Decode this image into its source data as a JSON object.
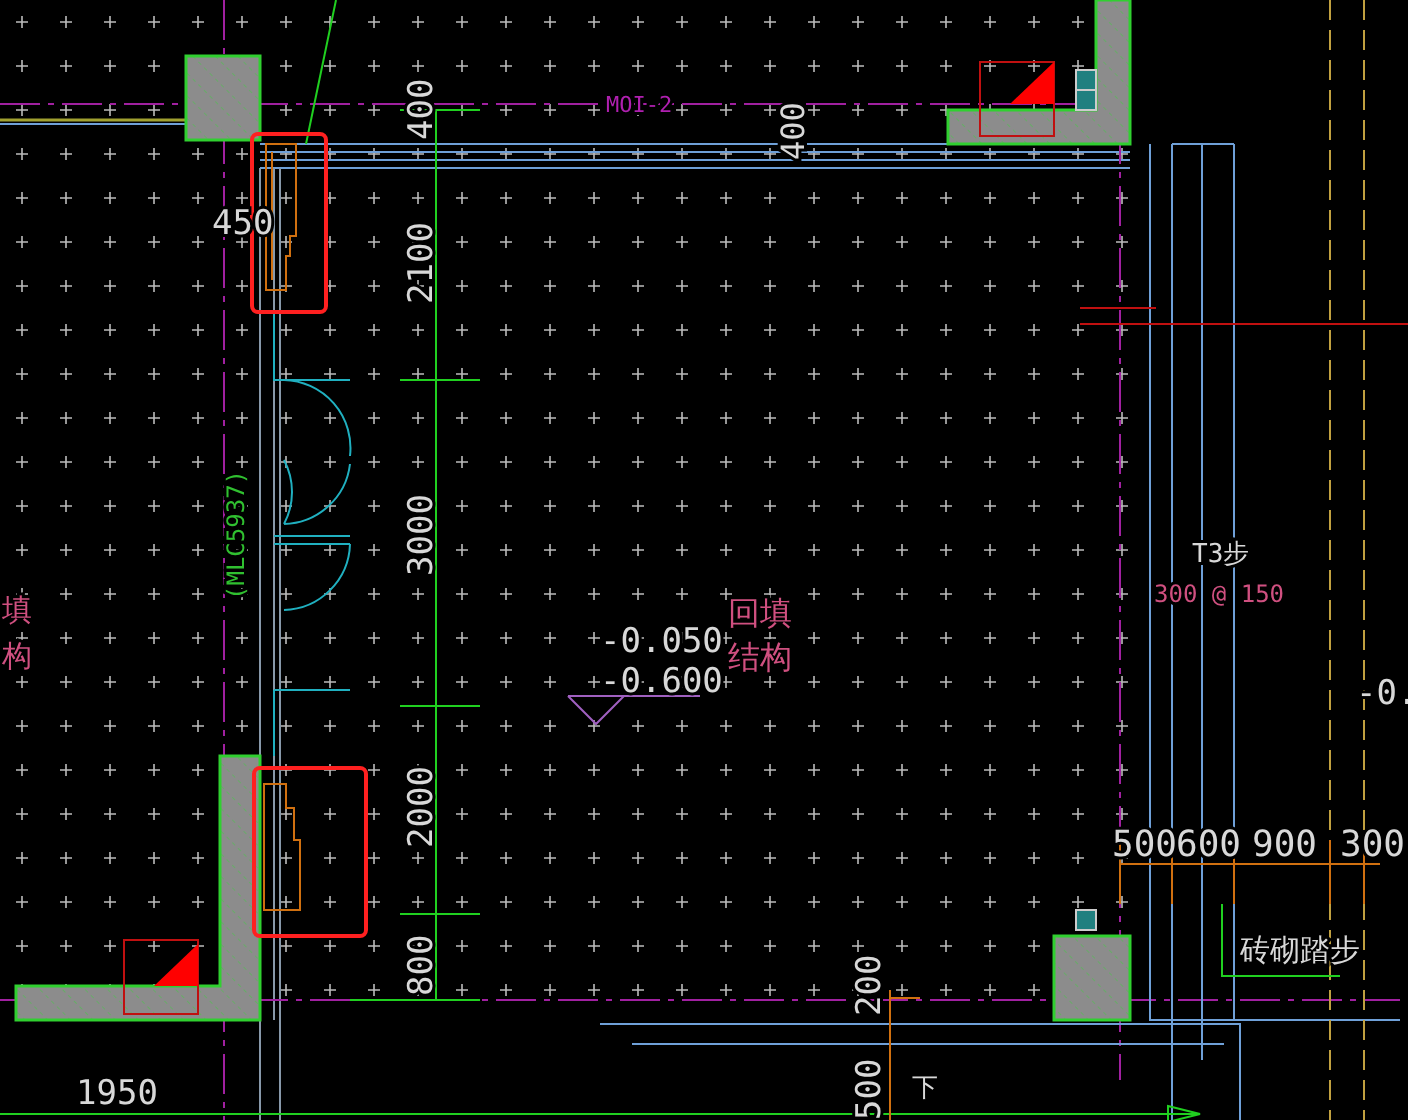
{
  "canvas": {
    "labels": [
      {
        "kind": "tag",
        "text": "MOI-2"
      },
      {
        "kind": "dim",
        "text": "450"
      },
      {
        "kind": "dimv",
        "text": "400"
      },
      {
        "kind": "dimv",
        "text": "2100"
      },
      {
        "kind": "dimv",
        "text": "3000"
      },
      {
        "kind": "dimv",
        "text": "2000"
      },
      {
        "kind": "dimv",
        "text": "800"
      },
      {
        "kind": "dimv",
        "text": "400"
      },
      {
        "kind": "tagv",
        "text": "(MLC5937)"
      },
      {
        "kind": "note",
        "text": "填"
      },
      {
        "kind": "note",
        "text": "构"
      },
      {
        "kind": "dim",
        "text": "-0.050"
      },
      {
        "kind": "dim",
        "text": "-0.600"
      },
      {
        "kind": "note",
        "text": "回填"
      },
      {
        "kind": "note",
        "text": "结构"
      },
      {
        "kind": "dim",
        "text": "T3步"
      },
      {
        "kind": "note",
        "text": "300 @ 150"
      },
      {
        "kind": "dim",
        "text": "-0."
      },
      {
        "kind": "dim",
        "text": "500"
      },
      {
        "kind": "dim",
        "text": "600"
      },
      {
        "kind": "dim",
        "text": "900"
      },
      {
        "kind": "dim",
        "text": "300"
      },
      {
        "kind": "dim",
        "text": "砖砌踏步"
      },
      {
        "kind": "dim",
        "text": "1950"
      },
      {
        "kind": "dimv",
        "text": "200"
      },
      {
        "kind": "dimv",
        "text": "500"
      },
      {
        "kind": "dim",
        "text": "下"
      }
    ]
  }
}
